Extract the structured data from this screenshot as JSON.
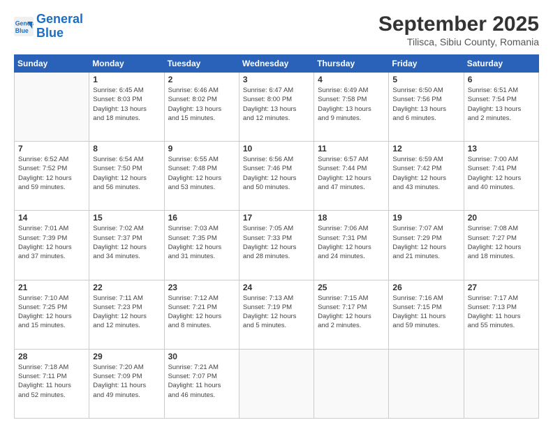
{
  "logo": {
    "line1": "General",
    "line2": "Blue"
  },
  "title": "September 2025",
  "subtitle": "Tilisca, Sibiu County, Romania",
  "weekdays": [
    "Sunday",
    "Monday",
    "Tuesday",
    "Wednesday",
    "Thursday",
    "Friday",
    "Saturday"
  ],
  "weeks": [
    [
      {
        "day": "",
        "info": ""
      },
      {
        "day": "1",
        "info": "Sunrise: 6:45 AM\nSunset: 8:03 PM\nDaylight: 13 hours\nand 18 minutes."
      },
      {
        "day": "2",
        "info": "Sunrise: 6:46 AM\nSunset: 8:02 PM\nDaylight: 13 hours\nand 15 minutes."
      },
      {
        "day": "3",
        "info": "Sunrise: 6:47 AM\nSunset: 8:00 PM\nDaylight: 13 hours\nand 12 minutes."
      },
      {
        "day": "4",
        "info": "Sunrise: 6:49 AM\nSunset: 7:58 PM\nDaylight: 13 hours\nand 9 minutes."
      },
      {
        "day": "5",
        "info": "Sunrise: 6:50 AM\nSunset: 7:56 PM\nDaylight: 13 hours\nand 6 minutes."
      },
      {
        "day": "6",
        "info": "Sunrise: 6:51 AM\nSunset: 7:54 PM\nDaylight: 13 hours\nand 2 minutes."
      }
    ],
    [
      {
        "day": "7",
        "info": "Sunrise: 6:52 AM\nSunset: 7:52 PM\nDaylight: 12 hours\nand 59 minutes."
      },
      {
        "day": "8",
        "info": "Sunrise: 6:54 AM\nSunset: 7:50 PM\nDaylight: 12 hours\nand 56 minutes."
      },
      {
        "day": "9",
        "info": "Sunrise: 6:55 AM\nSunset: 7:48 PM\nDaylight: 12 hours\nand 53 minutes."
      },
      {
        "day": "10",
        "info": "Sunrise: 6:56 AM\nSunset: 7:46 PM\nDaylight: 12 hours\nand 50 minutes."
      },
      {
        "day": "11",
        "info": "Sunrise: 6:57 AM\nSunset: 7:44 PM\nDaylight: 12 hours\nand 47 minutes."
      },
      {
        "day": "12",
        "info": "Sunrise: 6:59 AM\nSunset: 7:42 PM\nDaylight: 12 hours\nand 43 minutes."
      },
      {
        "day": "13",
        "info": "Sunrise: 7:00 AM\nSunset: 7:41 PM\nDaylight: 12 hours\nand 40 minutes."
      }
    ],
    [
      {
        "day": "14",
        "info": "Sunrise: 7:01 AM\nSunset: 7:39 PM\nDaylight: 12 hours\nand 37 minutes."
      },
      {
        "day": "15",
        "info": "Sunrise: 7:02 AM\nSunset: 7:37 PM\nDaylight: 12 hours\nand 34 minutes."
      },
      {
        "day": "16",
        "info": "Sunrise: 7:03 AM\nSunset: 7:35 PM\nDaylight: 12 hours\nand 31 minutes."
      },
      {
        "day": "17",
        "info": "Sunrise: 7:05 AM\nSunset: 7:33 PM\nDaylight: 12 hours\nand 28 minutes."
      },
      {
        "day": "18",
        "info": "Sunrise: 7:06 AM\nSunset: 7:31 PM\nDaylight: 12 hours\nand 24 minutes."
      },
      {
        "day": "19",
        "info": "Sunrise: 7:07 AM\nSunset: 7:29 PM\nDaylight: 12 hours\nand 21 minutes."
      },
      {
        "day": "20",
        "info": "Sunrise: 7:08 AM\nSunset: 7:27 PM\nDaylight: 12 hours\nand 18 minutes."
      }
    ],
    [
      {
        "day": "21",
        "info": "Sunrise: 7:10 AM\nSunset: 7:25 PM\nDaylight: 12 hours\nand 15 minutes."
      },
      {
        "day": "22",
        "info": "Sunrise: 7:11 AM\nSunset: 7:23 PM\nDaylight: 12 hours\nand 12 minutes."
      },
      {
        "day": "23",
        "info": "Sunrise: 7:12 AM\nSunset: 7:21 PM\nDaylight: 12 hours\nand 8 minutes."
      },
      {
        "day": "24",
        "info": "Sunrise: 7:13 AM\nSunset: 7:19 PM\nDaylight: 12 hours\nand 5 minutes."
      },
      {
        "day": "25",
        "info": "Sunrise: 7:15 AM\nSunset: 7:17 PM\nDaylight: 12 hours\nand 2 minutes."
      },
      {
        "day": "26",
        "info": "Sunrise: 7:16 AM\nSunset: 7:15 PM\nDaylight: 11 hours\nand 59 minutes."
      },
      {
        "day": "27",
        "info": "Sunrise: 7:17 AM\nSunset: 7:13 PM\nDaylight: 11 hours\nand 55 minutes."
      }
    ],
    [
      {
        "day": "28",
        "info": "Sunrise: 7:18 AM\nSunset: 7:11 PM\nDaylight: 11 hours\nand 52 minutes."
      },
      {
        "day": "29",
        "info": "Sunrise: 7:20 AM\nSunset: 7:09 PM\nDaylight: 11 hours\nand 49 minutes."
      },
      {
        "day": "30",
        "info": "Sunrise: 7:21 AM\nSunset: 7:07 PM\nDaylight: 11 hours\nand 46 minutes."
      },
      {
        "day": "",
        "info": ""
      },
      {
        "day": "",
        "info": ""
      },
      {
        "day": "",
        "info": ""
      },
      {
        "day": "",
        "info": ""
      }
    ]
  ]
}
